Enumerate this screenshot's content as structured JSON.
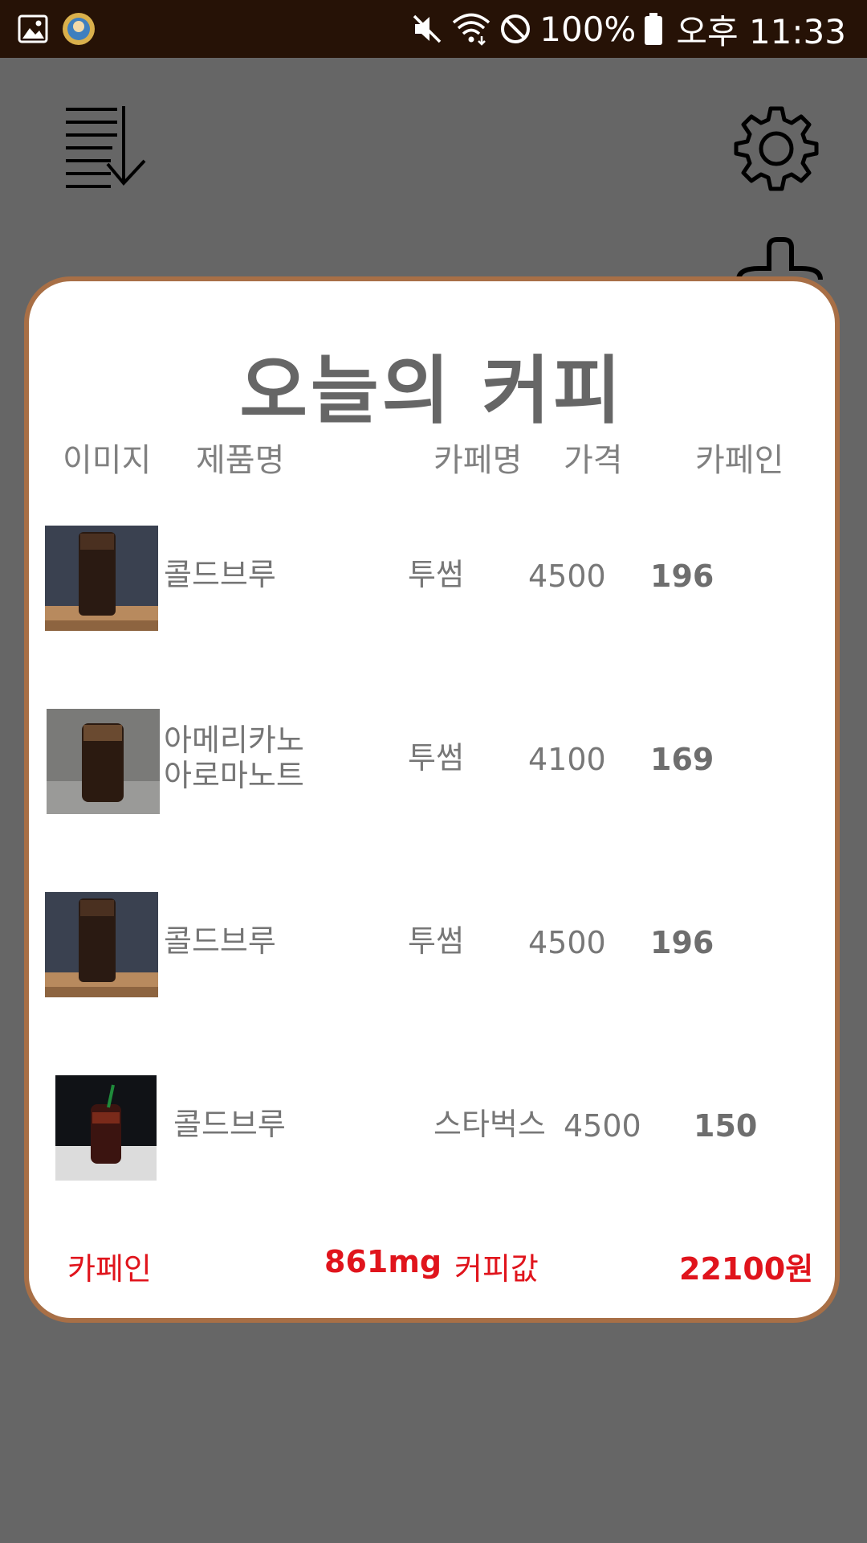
{
  "status_bar": {
    "battery": "100%",
    "time": "오후 11:33",
    "icons": [
      "gallery-icon",
      "avatar-icon",
      "mute-icon",
      "wifi-icon",
      "blocked-icon",
      "battery-icon"
    ]
  },
  "app_bar": {
    "icons": [
      "sort-list-icon",
      "settings-icon",
      "add-icon"
    ]
  },
  "sheet": {
    "title": "오늘의 커피",
    "columns": [
      "이미지",
      "제품명",
      "카페명",
      "가격",
      "카페인"
    ],
    "rows": [
      {
        "name": "콜드브루",
        "cafe": "투썸",
        "price": "4500",
        "caffeine": "196"
      },
      {
        "name": "아메리카노\n아로마노트",
        "cafe": "투썸",
        "price": "4100",
        "caffeine": "169"
      },
      {
        "name": "콜드브루",
        "cafe": "투썸",
        "price": "4500",
        "caffeine": "196"
      },
      {
        "name": "콜드브루",
        "cafe": "스타벅스",
        "price": "4500",
        "caffeine": "150"
      }
    ],
    "summary": {
      "caffeine_label": "카페인",
      "caffeine_value": "861mg",
      "price_label": "커피값",
      "price_value": "22100원"
    }
  },
  "colors": {
    "accent_border": "#a86f46",
    "summary_red": "#e0141c",
    "overlay": "#666666",
    "status_bar": "#261206"
  }
}
